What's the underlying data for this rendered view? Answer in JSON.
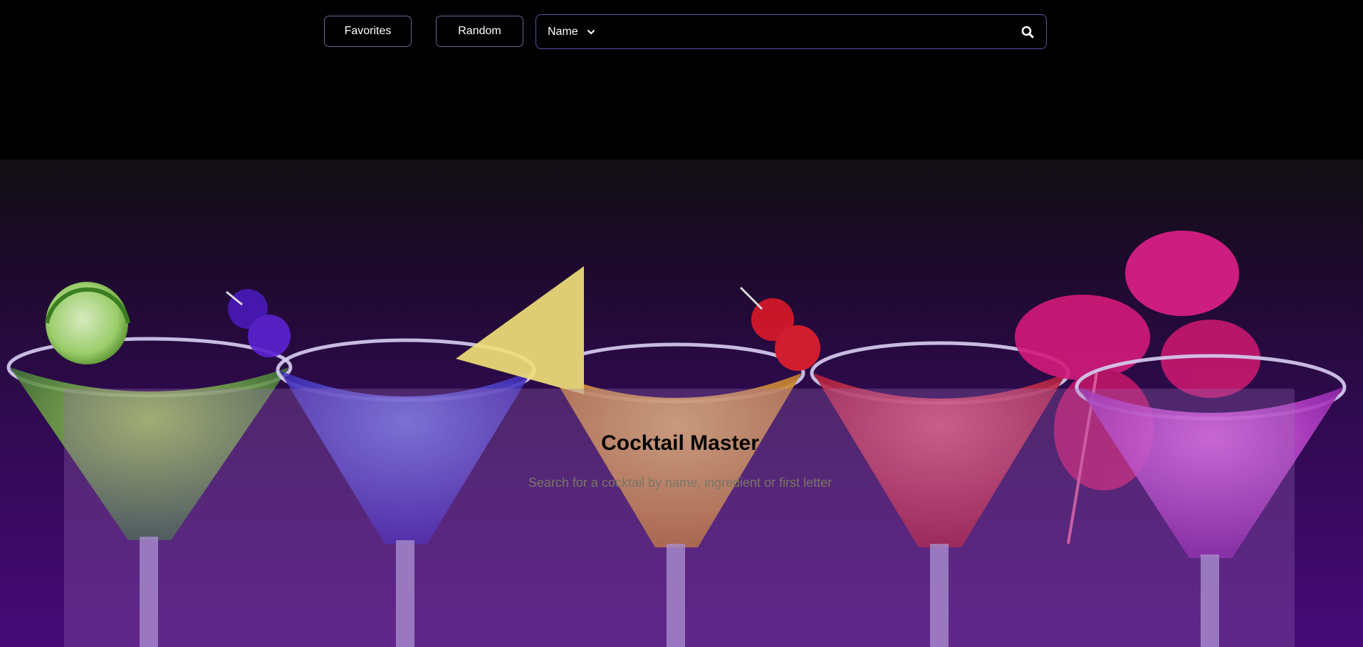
{
  "nav": {
    "favorites_label": "Favorites",
    "random_label": "Random"
  },
  "search": {
    "mode_selected": "Name",
    "value": "",
    "placeholder": "",
    "icon": "search-icon"
  },
  "hero": {
    "title": "Cocktail Master",
    "subtitle": "Search for a cocktail by name, ingredient or first letter",
    "image": "martini-glasses-row-with-garnishes"
  },
  "colors": {
    "background": "#000000",
    "button_border": "#6a6690",
    "search_border": "#5a53a8",
    "hero_gradient_end": "#460a78"
  }
}
